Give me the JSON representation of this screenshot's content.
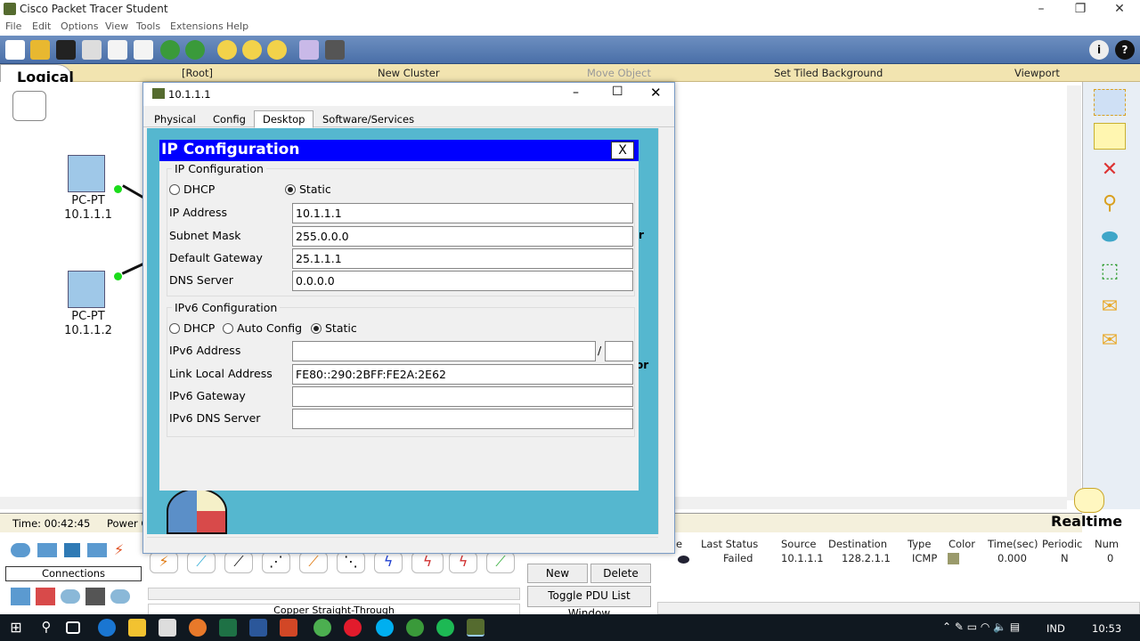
{
  "app": {
    "title": "Cisco Packet Tracer Student"
  },
  "menu": [
    "File",
    "Edit",
    "Options",
    "View",
    "Tools",
    "Extensions",
    "Help"
  ],
  "strip": {
    "tab": "Logical",
    "root": "[Root]",
    "new_cluster": "New Cluster",
    "move_object": "Move Object",
    "tiled_bg": "Set Tiled Background",
    "viewport": "Viewport"
  },
  "devices": [
    {
      "name": "PC-PT",
      "ip": "10.1.1.1"
    },
    {
      "name": "PC-PT",
      "ip": "10.1.1.2"
    }
  ],
  "status": {
    "time": "Time: 00:42:45",
    "power": "Power C",
    "realtime": "Realtime"
  },
  "connections": {
    "label": "Connections",
    "selected": "Copper Straight-Through"
  },
  "pdu": {
    "new": "New",
    "delete": "Delete",
    "toggle": "Toggle PDU List Window"
  },
  "pdu_table": {
    "headers": [
      "e",
      "Last Status",
      "Source",
      "Destination",
      "Type",
      "Color",
      "Time(sec)",
      "Periodic",
      "Num"
    ],
    "row": {
      "status": "Failed",
      "source": "10.1.1.1",
      "destination": "128.2.1.1",
      "type": "ICMP",
      "color": "#9a9a6b",
      "time": "0.000",
      "periodic": "N",
      "num": "0"
    }
  },
  "dialog": {
    "title": "10.1.1.1",
    "tabs": [
      "Physical",
      "Config",
      "Desktop",
      "Software/Services"
    ],
    "active_tab": "Desktop",
    "side_text_1": "r",
    "side_text_2": "or"
  },
  "ipconfig": {
    "header": "IP Configuration",
    "close": "X",
    "ipv4_group": "IP Configuration",
    "dhcp": "DHCP",
    "static": "Static",
    "ip_label": "IP Address",
    "ip_value": "10.1.1.1",
    "mask_label": "Subnet Mask",
    "mask_value": "255.0.0.0",
    "gw_label": "Default Gateway",
    "gw_value": "25.1.1.1",
    "dns_label": "DNS Server",
    "dns_value": "0.0.0.0",
    "ipv6_group": "IPv6 Configuration",
    "v6_dhcp": "DHCP",
    "v6_auto": "Auto Config",
    "v6_static": "Static",
    "v6_addr_label": "IPv6 Address",
    "v6_addr_value": "",
    "v6_slash": "/",
    "v6_prefix": "",
    "ll_label": "Link Local Address",
    "ll_value": "FE80::290:2BFF:FE2A:2E62",
    "v6_gw_label": "IPv6 Gateway",
    "v6_gw_value": "",
    "v6_dns_label": "IPv6 DNS Server",
    "v6_dns_value": ""
  },
  "taskbar": {
    "lang": "IND",
    "clock": "10:53"
  }
}
